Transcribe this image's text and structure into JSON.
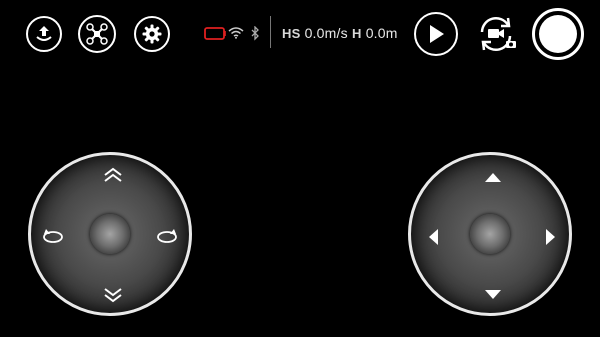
{
  "toolbar": {
    "left_buttons": [
      {
        "name": "takeoff-button",
        "icon": "takeoff-icon"
      },
      {
        "name": "drone-mode-button",
        "icon": "drone-icon"
      },
      {
        "name": "settings-button",
        "icon": "gear-icon"
      }
    ],
    "status": {
      "battery_icon": "battery-icon",
      "wifi_icon": "wifi-icon",
      "bluetooth_icon": "bluetooth-icon",
      "hs_label": "HS",
      "hs_value": "0.0m/s",
      "h_label": "H",
      "h_value": "0.0m"
    },
    "right_buttons": [
      {
        "name": "play-button",
        "icon": "play-icon"
      },
      {
        "name": "camera-switch-button",
        "icon": "camera-switch-icon"
      },
      {
        "name": "shutter-button",
        "icon": "shutter-icon"
      }
    ]
  },
  "joysticks": {
    "left": {
      "up": "double-chevron-up-icon",
      "down": "double-chevron-down-icon",
      "left": "rotate-ccw-icon",
      "right": "rotate-cw-icon"
    },
    "right": {
      "up": "triangle-up-icon",
      "down": "triangle-down-icon",
      "left": "triangle-left-icon",
      "right": "triangle-right-icon"
    }
  },
  "colors": {
    "background": "#000000",
    "battery_warning": "#e02020",
    "foreground": "#ffffff"
  }
}
